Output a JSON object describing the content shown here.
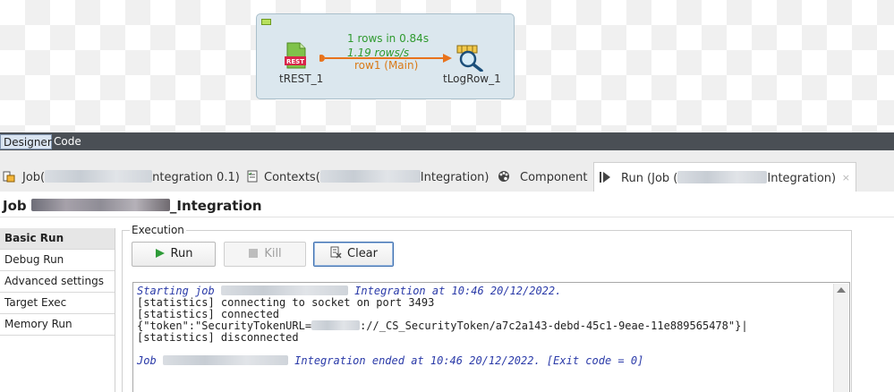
{
  "designer": {
    "subjob": {
      "component_in": "tREST_1",
      "component_out": "tLogRow_1",
      "rows_stat": "1 rows in 0.84s",
      "rate_stat": "1.19 rows/s",
      "link_label": "row1 (Main)",
      "rest_badge": "REST"
    },
    "editor_tabs": [
      {
        "label": "Designer",
        "active": true
      },
      {
        "label": "Code",
        "active": false
      }
    ]
  },
  "view_tabs": {
    "job_tab": {
      "prefix": "Job(",
      "suffix": "ntegration 0.1)"
    },
    "contexts_tab": {
      "prefix": "Contexts(",
      "suffix": "Integration)"
    },
    "component_tab": {
      "label": "Component"
    },
    "run_tab": {
      "prefix": "Run (Job (",
      "suffix": "Integration)",
      "close": "×"
    }
  },
  "run_panel": {
    "title_prefix": "Job",
    "title_suffix": "_Integration",
    "nav": [
      {
        "label": "Basic Run",
        "active": true
      },
      {
        "label": "Debug Run",
        "active": false
      },
      {
        "label": "Advanced settings",
        "active": false
      },
      {
        "label": "Target Exec",
        "active": false
      },
      {
        "label": "Memory Run",
        "active": false
      }
    ],
    "execution_label": "Execution",
    "buttons": {
      "run": "Run",
      "kill": "Kill",
      "clear": "Clear"
    },
    "console": {
      "start_prefix": "Starting job",
      "start_suffix": "Integration at 10:46 20/12/2022.",
      "line2": "[statistics] connecting to socket on port 3493",
      "line3": "[statistics] connected",
      "token_prefix": "{\"token\":\"SecurityTokenURL=",
      "token_suffix": "://_CS_SecurityToken/a7c2a143-debd-45c1-9eae-11e889565478\"}|",
      "line5": "[statistics] disconnected",
      "end_prefix": "Job",
      "end_suffix": "Integration ended at 10:46 20/12/2022. [Exit code  = 0]"
    }
  },
  "colors": {
    "stats_green": "#2f9a2f",
    "link_orange": "#d97a18",
    "console_blue": "#2a3aa8"
  }
}
